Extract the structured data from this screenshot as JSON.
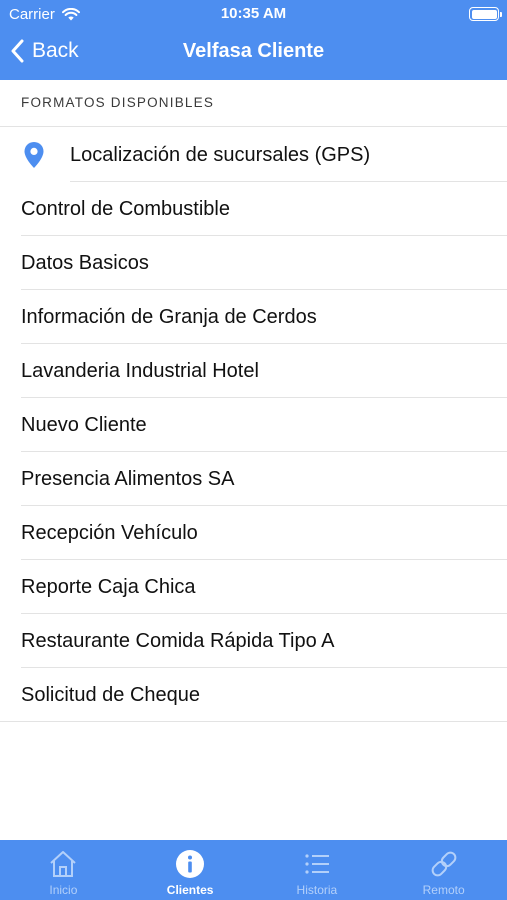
{
  "status_bar": {
    "carrier": "Carrier",
    "time": "10:35 AM"
  },
  "navbar": {
    "back_label": "Back",
    "title": "Velfasa Cliente"
  },
  "section": {
    "header": "FORMATOS DISPONIBLES"
  },
  "list": {
    "items": [
      {
        "label": "Localización de sucursales (GPS)",
        "icon": "location-pin-icon"
      },
      {
        "label": "Control de Combustible"
      },
      {
        "label": "Datos Basicos"
      },
      {
        "label": "Información de Granja de Cerdos"
      },
      {
        "label": "Lavanderia Industrial Hotel"
      },
      {
        "label": "Nuevo Cliente"
      },
      {
        "label": "Presencia Alimentos SA"
      },
      {
        "label": "Recepción Vehículo"
      },
      {
        "label": "Reporte Caja Chica"
      },
      {
        "label": "Restaurante Comida Rápida Tipo A"
      },
      {
        "label": "Solicitud de Cheque"
      }
    ]
  },
  "tabbar": {
    "tabs": [
      {
        "label": "Inicio",
        "icon": "home-icon",
        "active": false
      },
      {
        "label": "Clientes",
        "icon": "info-icon",
        "active": true
      },
      {
        "label": "Historia",
        "icon": "list-icon",
        "active": false
      },
      {
        "label": "Remoto",
        "icon": "link-icon",
        "active": false
      }
    ]
  },
  "colors": {
    "accent": "#4d8ef0",
    "tab_inactive": "#b3d0fa",
    "separator": "#e3e3e3"
  }
}
